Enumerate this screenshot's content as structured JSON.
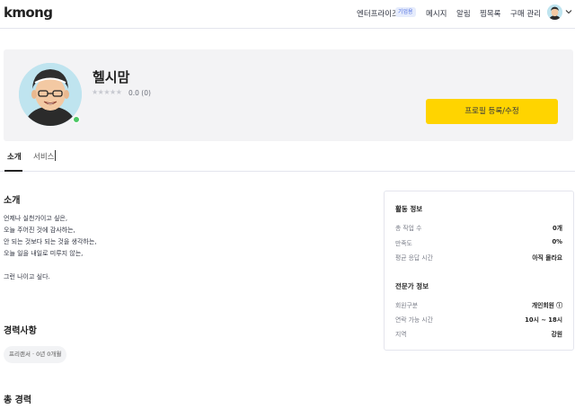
{
  "header": {
    "logo": "kmong",
    "nav": {
      "enterprise": "엔터프라이즈",
      "enterprise_badge": "기업용",
      "messages": "메시지",
      "alarm": "알림",
      "favorites": "찜목록",
      "purchases": "구매 관리"
    }
  },
  "profile": {
    "nickname": "헬시맘",
    "stars": "★★★★★",
    "rating": "0.0 (0)",
    "edit_button": "프로필 등록/수정"
  },
  "tabs": {
    "intro": "소개",
    "service": "서비스"
  },
  "intro": {
    "title": "소개",
    "text": "언제나 실천가이고 싶은,\n오늘 주어진 것에 감사하는,\n안 되는 것보다 되는 것을 생각하는,\n오늘 일을 내일로 미루지 않는,\n\n그런 나이고 싶다."
  },
  "career": {
    "title": "경력사항",
    "tag": "프리랜서 · 0년 0개월"
  },
  "total_career": {
    "title": "총 경력"
  },
  "activity": {
    "title": "활동 정보",
    "rows": [
      {
        "label": "총 작업 수",
        "value": "0개"
      },
      {
        "label": "만족도",
        "value": "0%"
      },
      {
        "label": "평균 응답 시간",
        "value": "아직 몰라요"
      }
    ]
  },
  "expert": {
    "title": "전문가 정보",
    "rows": [
      {
        "label": "회원구분",
        "value": "개인회원 ⓘ"
      },
      {
        "label": "연락 가능 시간",
        "value": "10시 ~ 18시"
      },
      {
        "label": "지역",
        "value": "강원"
      }
    ]
  },
  "colors": {
    "accent": "#ffd400",
    "online": "#4cc764",
    "badge_text": "#4d6de0"
  },
  "icons": {
    "header_avatar": "avatar-icon",
    "chevron": "chevron-down-icon"
  }
}
